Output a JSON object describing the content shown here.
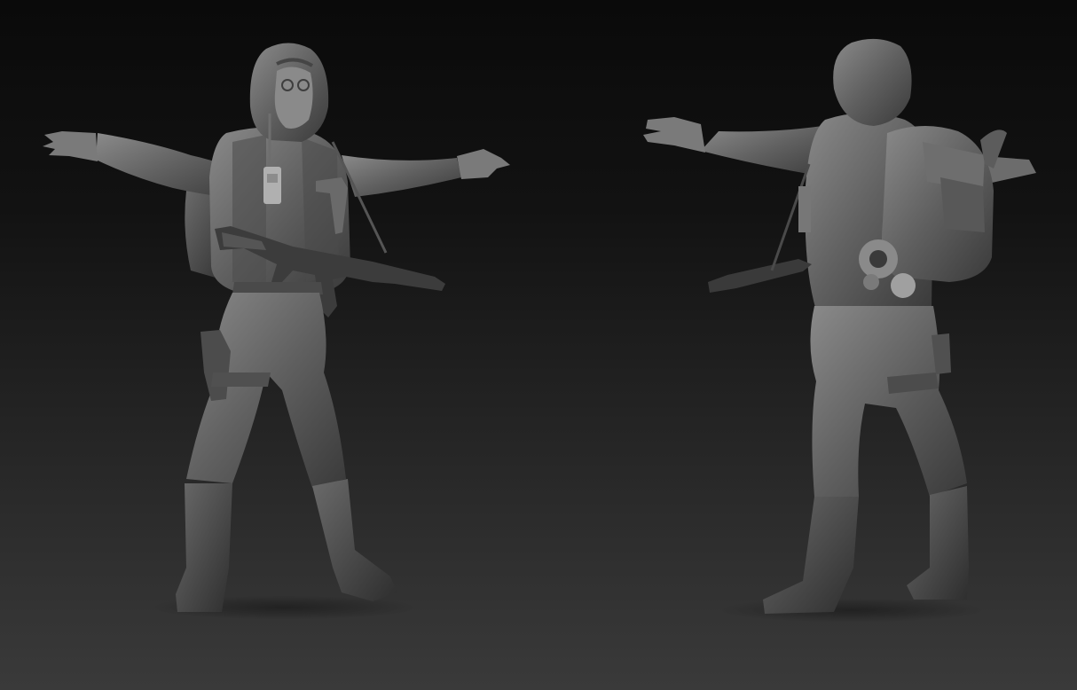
{
  "scene": {
    "background_top": "#0a0a0a",
    "background_bottom": "#3a3a3a",
    "material_light": "#7a7a7a",
    "material_mid": "#5a5a5a",
    "material_dark": "#3a3a3a",
    "views": [
      {
        "id": "front",
        "kind": "front-view"
      },
      {
        "id": "back",
        "kind": "back-view"
      }
    ]
  }
}
